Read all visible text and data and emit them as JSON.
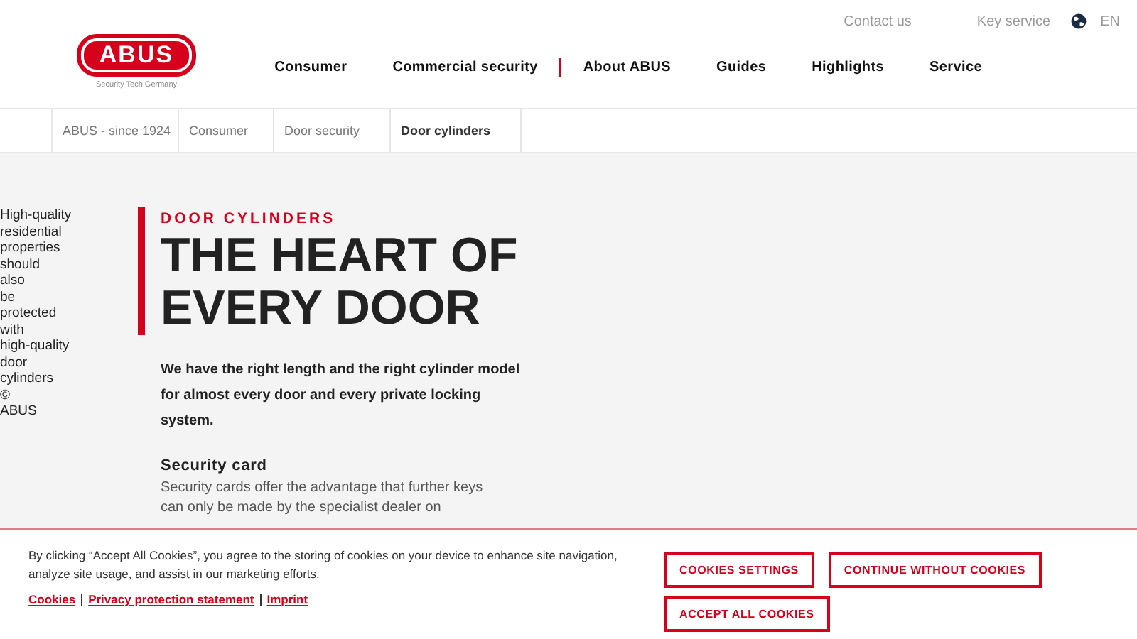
{
  "logo": {
    "brand": "ABUS",
    "tagline": "Security Tech Germany"
  },
  "top_links": [
    "Contact us",
    "Key service"
  ],
  "language": "EN",
  "nav": [
    {
      "label": "Consumer",
      "selected": false
    },
    {
      "label": "Commercial security",
      "selected": false
    },
    {
      "label": "About ABUS",
      "selected": true
    },
    {
      "label": "Guides",
      "selected": false
    },
    {
      "label": "Highlights",
      "selected": false
    },
    {
      "label": "Service",
      "selected": false
    }
  ],
  "breadcrumb": [
    {
      "label": "ABUS - since 1924",
      "selected": false
    },
    {
      "label": "Consumer",
      "selected": false
    },
    {
      "label": "Door security",
      "selected": false
    },
    {
      "label": "Door cylinders",
      "selected": true
    }
  ],
  "image_alt": "High-quality residential properties should also be protected with high-quality door cylinders © ABUS",
  "eyebrow": "DOOR CYLINDERS",
  "heading": [
    "THE HEART OF",
    "EVERY DOOR"
  ],
  "intro": "We have the right length and the right cylinder model for almost every door and every private locking system.",
  "section_title": "Security card",
  "section_text": [
    "Security cards offer the advantage that further keys",
    "can only be made by the specialist dealer on"
  ],
  "cookie_banner": {
    "text": "By clicking “Accept All Cookies”, you agree to the storing of cookies on your device to enhance site navigation, analyze site usage, and assist in our marketing efforts.",
    "links": [
      "Cookies",
      "Privacy protection statement",
      "Imprint"
    ],
    "buttons": [
      "COOKIES SETTINGS",
      "CONTINUE WITHOUT COOKIES",
      "ACCEPT ALL COOKIES"
    ]
  }
}
